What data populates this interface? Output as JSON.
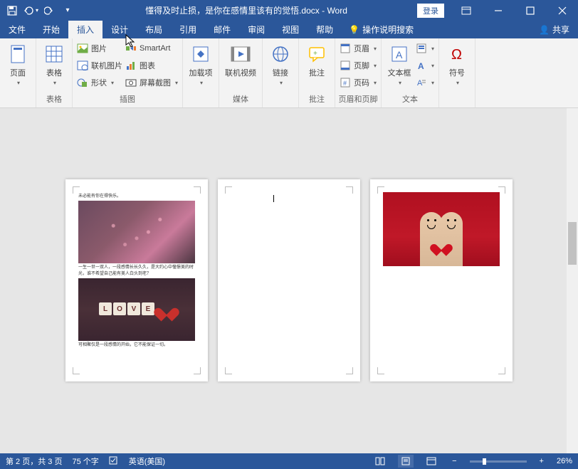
{
  "titlebar": {
    "doc_title": "懂得及时止损，是你在感情里该有的觉悟.docx - Word",
    "login": "登录"
  },
  "tabs": {
    "file": "文件",
    "home": "开始",
    "insert": "插入",
    "design": "设计",
    "layout": "布局",
    "references": "引用",
    "mailings": "邮件",
    "review": "审阅",
    "view": "视图",
    "help": "帮助",
    "tell_me": "操作说明搜索",
    "share": "共享"
  },
  "ribbon": {
    "pages": {
      "page": "页面",
      "label": ""
    },
    "tables": {
      "table": "表格",
      "label": "表格"
    },
    "illustrations": {
      "pictures": "图片",
      "online_pictures": "联机图片",
      "shapes": "形状",
      "smartart": "SmartArt",
      "chart": "图表",
      "screenshot": "屏幕截图",
      "label": "插图"
    },
    "addins": {
      "addins": "加载项",
      "label": ""
    },
    "media": {
      "online_video": "联机视频",
      "label": "媒体"
    },
    "links": {
      "links": "链接",
      "label": ""
    },
    "comments": {
      "comment": "批注",
      "label": "批注"
    },
    "header_footer": {
      "header": "页眉",
      "footer": "页脚",
      "page_number": "页码",
      "label": "页眉和页脚"
    },
    "text": {
      "textbox": "文本框",
      "label": "文本"
    },
    "symbols": {
      "symbol": "符号",
      "label": ""
    }
  },
  "document": {
    "page1": {
      "text1": "未必能有你在得快乐。",
      "text2": "一生一世一双人，一段感情长长久久，是大约心中憧憬美的时光，谁不希望自己能有美人白头到老？",
      "text3": "可相聚仅是一段感情的开始，它不能保证一切。"
    }
  },
  "statusbar": {
    "page_info": "第 2 页，共 3 页",
    "word_count": "75 个字",
    "language": "英语(美国)",
    "zoom_minus": "−",
    "zoom_plus": "+",
    "zoom": "26%"
  }
}
